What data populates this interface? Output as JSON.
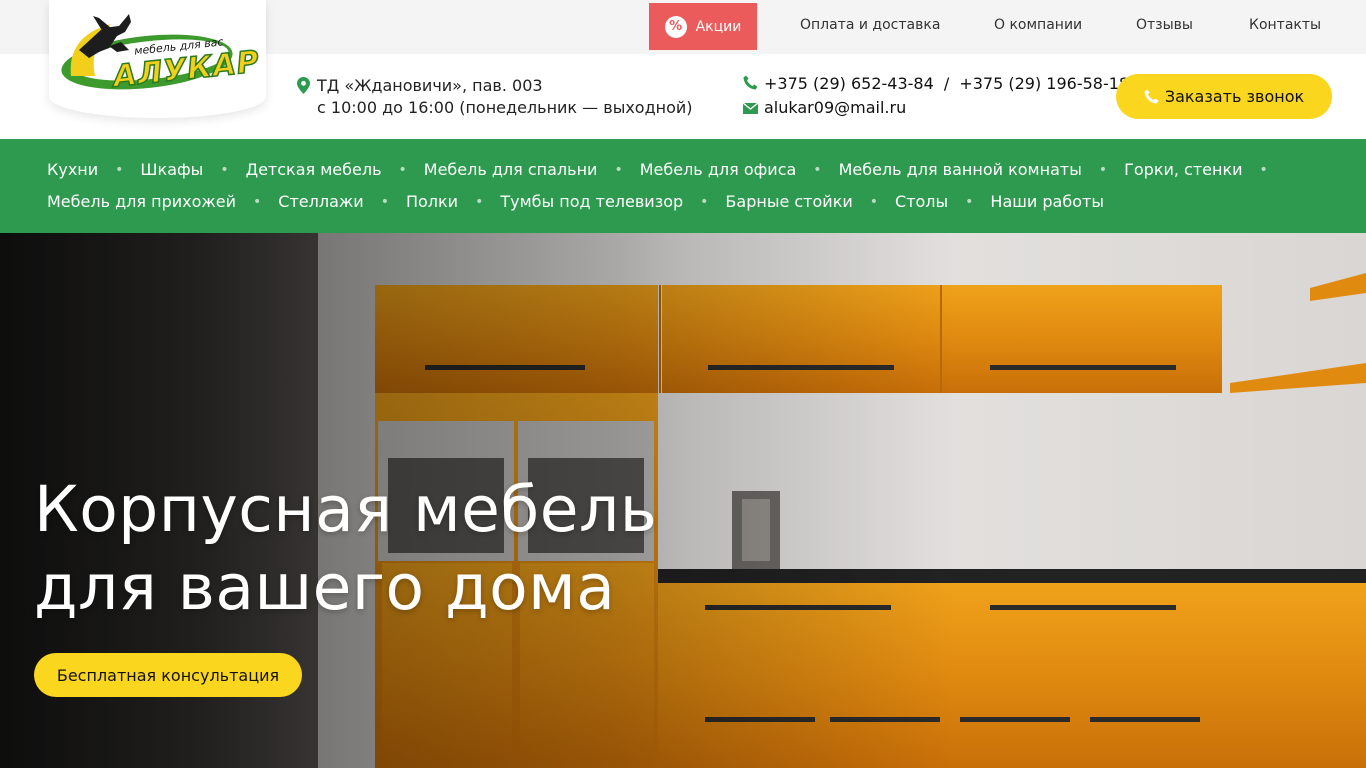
{
  "colors": {
    "brand_green": "#2e9a4f",
    "accent_yellow": "#fbd61e",
    "promo_red": "#ec5b5b",
    "topbar_bg": "#f4f4f4"
  },
  "logo": {
    "name": "АЛУКАР",
    "tagline": "мебель для вас",
    "icon": "eagle-logo-icon"
  },
  "topnav": {
    "promo": {
      "label": "Акции",
      "icon": "percent-icon"
    },
    "links": [
      "Оплата и доставка",
      "О компании",
      "Отзывы",
      "Контакты"
    ]
  },
  "info": {
    "address_icon": "map-pin-icon",
    "address_line1": "ТД «Ждановичи», пав. 003",
    "address_line2": "с 10:00 до 16:00 (понедельник — выходной)",
    "phone_icon": "phone-icon",
    "phone1": "+375 (29) 652-43-84",
    "phone_separator": "/",
    "phone2": "+375 (29) 196-58-18",
    "email_icon": "mail-icon",
    "email": "alukar09@mail.ru",
    "callback_label": "Заказать звонок"
  },
  "menu": {
    "row1": [
      "Кухни",
      "Шкафы",
      "Детская мебель",
      "Мебель для спальни",
      "Мебель для офиса",
      "Мебель для ванной комнаты",
      "Горки, стенки"
    ],
    "row2": [
      "Мебель для прихожей",
      "Стеллажи",
      "Полки",
      "Тумбы под телевизор",
      "Барные стойки",
      "Столы",
      "Наши работы"
    ]
  },
  "hero": {
    "title_line1": "Корпусная мебель",
    "title_line2": "для вашего дома",
    "cta_label": "Бесплатная консультация"
  }
}
